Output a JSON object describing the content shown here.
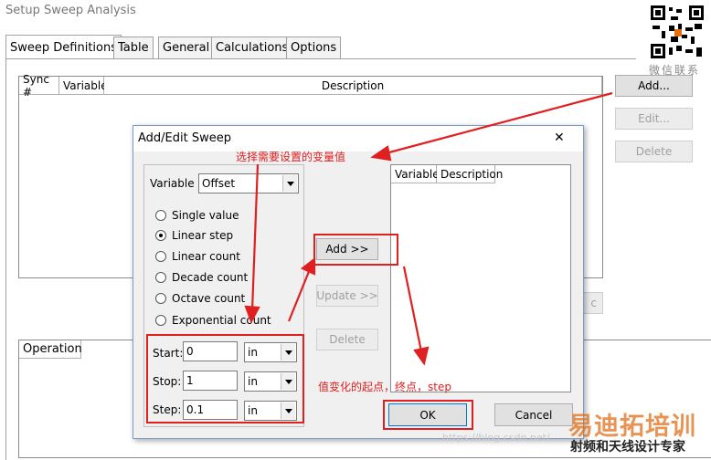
{
  "window": {
    "title": "Setup Sweep Analysis"
  },
  "tabs": [
    {
      "label": "Sweep Definitions",
      "active": true
    },
    {
      "label": "Table"
    },
    {
      "label": "General"
    },
    {
      "label": "Calculations"
    },
    {
      "label": "Options"
    }
  ],
  "sweep_table": {
    "headers": [
      "Sync #",
      "Variable",
      "Description"
    ]
  },
  "side_buttons": {
    "add": "Add...",
    "edit": "Edit...",
    "delete": "Delete"
  },
  "partial_button": "c",
  "operation_header": "Operation",
  "qr": {
    "label": "微信联系"
  },
  "dialog": {
    "title": "Add/Edit Sweep",
    "close": "✕",
    "variable_label": "Variable",
    "variable_value": "Offset",
    "radios": [
      {
        "label": "Single value",
        "checked": false
      },
      {
        "label": "Linear step",
        "checked": true
      },
      {
        "label": "Linear count",
        "checked": false
      },
      {
        "label": "Decade count",
        "checked": false
      },
      {
        "label": "Octave count",
        "checked": false
      },
      {
        "label": "Exponential count",
        "checked": false
      }
    ],
    "fields": {
      "start_label": "Start:",
      "start_value": "0",
      "start_unit": "in",
      "stop_label": "Stop:",
      "stop_value": "1",
      "stop_unit": "in",
      "step_label": "Step:",
      "step_value": "0.1",
      "step_unit": "in"
    },
    "buttons": {
      "add": "Add >>",
      "update": "Update >>",
      "delete": "Delete",
      "ok": "OK",
      "cancel": "Cancel"
    },
    "list_headers": [
      "Variable",
      "Description"
    ]
  },
  "annotations": {
    "select_variable": "选择需要设置的变量值",
    "range": "值变化的起点，终点，step"
  },
  "watermark": {
    "url": "https://blog.csdn.net/...",
    "brand": "易迪拓培训",
    "subtitle": "射频和天线设计专家"
  },
  "colors": {
    "annotation": "#e02020",
    "brand": "#e0701a"
  }
}
